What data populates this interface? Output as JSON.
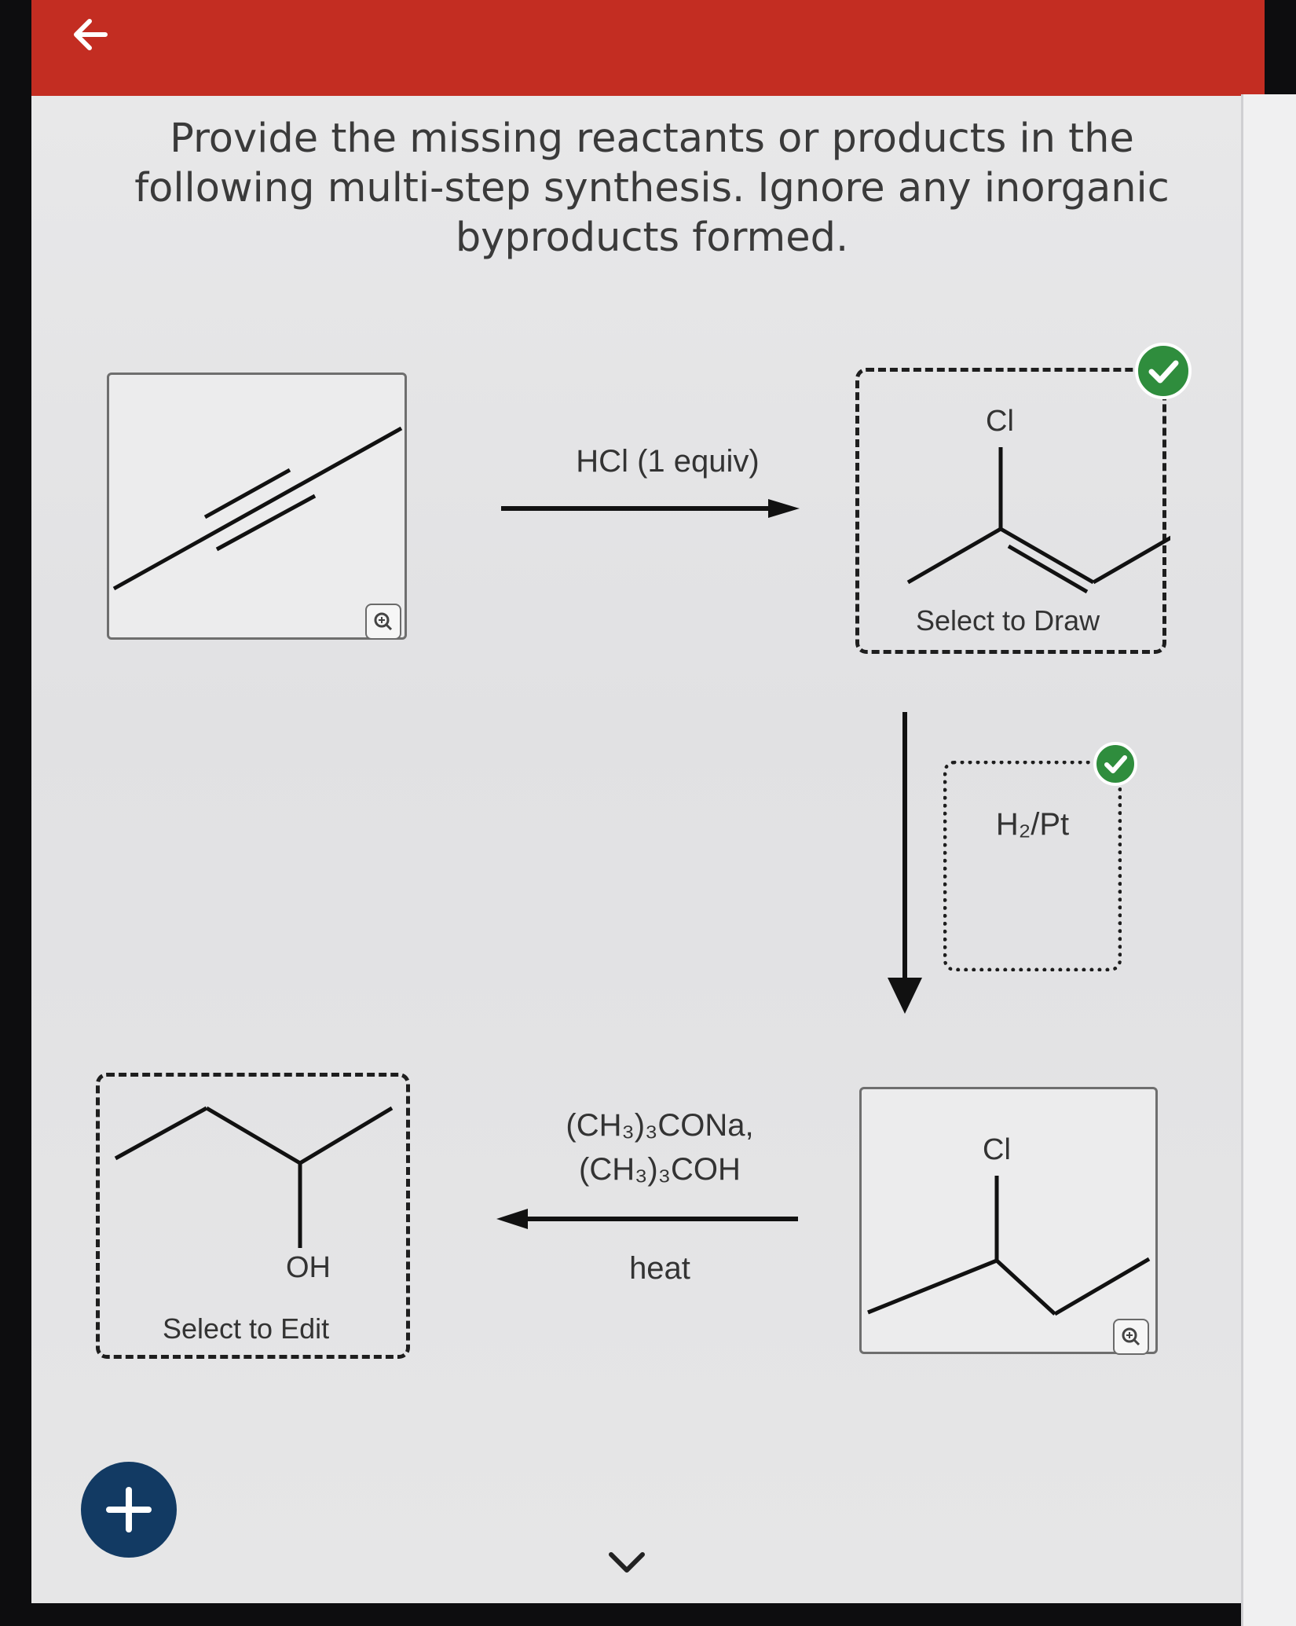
{
  "header": {
    "back_icon": "arrow-left-icon",
    "color": "#c32d22"
  },
  "question": {
    "text": "Provide the missing reactants or products in the following multi-step synthesis. Ignore any inorganic byproducts formed."
  },
  "scheme": {
    "step1": {
      "reagent": "HCl (1 equiv)"
    },
    "product1": {
      "atom_label": "Cl",
      "caption": "Select to Draw",
      "status": "correct"
    },
    "step2": {
      "reagent": "H₂/Pt",
      "status": "correct"
    },
    "product2": {
      "atom_label": "Cl"
    },
    "step3": {
      "reagent_line1": "(CH₃)₃CONa,",
      "reagent_line2": "(CH₃)₃COH",
      "condition": "heat"
    },
    "product3": {
      "atom_label": "OH",
      "caption": "Select to Edit"
    }
  },
  "controls": {
    "zoom_icon": "magnifier-icon",
    "add_icon": "plus-icon",
    "next_icon": "chevron-down-icon",
    "check_icon": "checkmark-icon",
    "check_color": "#2f8d3d",
    "add_color": "#123a63"
  }
}
